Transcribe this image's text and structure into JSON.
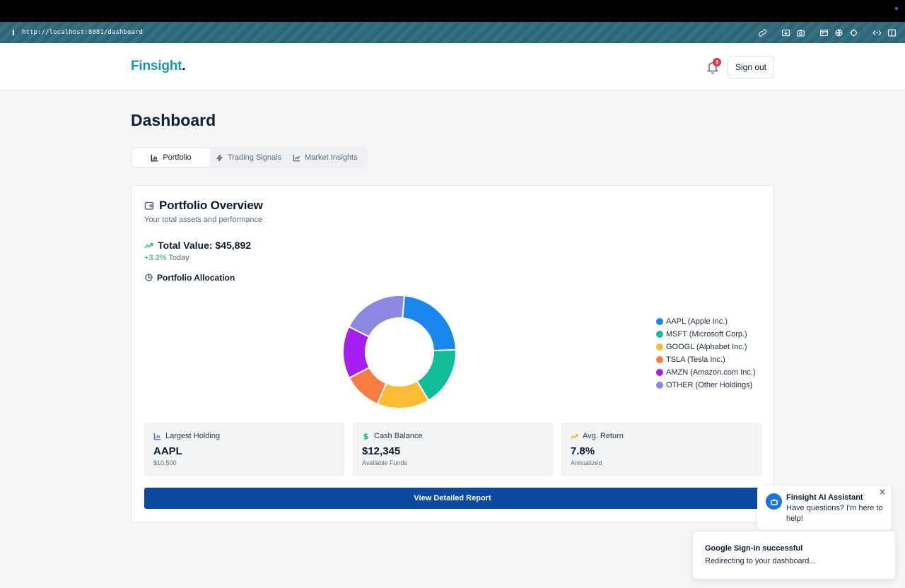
{
  "browser": {
    "url": "http://localhost:8081/dashboard",
    "info_glyph": "i",
    "toolbar_icons": [
      "link-icon",
      "download-icon",
      "camera-icon",
      "terminal-icon",
      "globe-icon",
      "crosshair-icon",
      "code-icon",
      "sidebar-icon"
    ]
  },
  "header": {
    "brand": "Finsight",
    "brand_suffix": ".",
    "notification_count": "3",
    "signout_label": "Sign out"
  },
  "page": {
    "title": "Dashboard"
  },
  "tabs": [
    {
      "label": "Portfolio",
      "icon": "bar-chart-icon",
      "active": true
    },
    {
      "label": "Trading Signals",
      "icon": "zap-icon",
      "active": false
    },
    {
      "label": "Market Insights",
      "icon": "line-chart-icon",
      "active": false
    }
  ],
  "overview": {
    "title": "Portfolio Overview",
    "subtitle": "Your total assets and performance",
    "total_value": "Total Value: $45,892",
    "change": "+3.2%",
    "change_suffix": " Today",
    "allocation_title": "Portfolio Allocation"
  },
  "chart_data": {
    "type": "pie",
    "donut": true,
    "title": "",
    "legend_position": "right",
    "categories": [
      "AAPL (Apple Inc.)",
      "MSFT (Microsoft Corp.)",
      "GOOGL (Alphabet Inc.)",
      "TSLA (Tesla Inc.)",
      "AMZN (Amazon.com Inc.)",
      "OTHER (Other Holdings)"
    ],
    "values": [
      23,
      17,
      15,
      11,
      15,
      19
    ],
    "colors": [
      "#1a87f0",
      "#12bd9a",
      "#fbbb33",
      "#fb7c43",
      "#a41ff0",
      "#8a88e0"
    ]
  },
  "stats": [
    {
      "label": "Largest Holding",
      "icon": "bar-chart-icon",
      "icon_color": "#4a6cf7",
      "value": "AAPL",
      "note": "$10,500"
    },
    {
      "label": "Cash Balance",
      "icon": "dollar-icon",
      "icon_color": "#22b05d",
      "value": "$12,345",
      "note": "Available Funds"
    },
    {
      "label": "Avg. Return",
      "icon": "trending-up-icon",
      "icon_color": "#f5a524",
      "value": "7.8%",
      "note": "Annualized"
    }
  ],
  "report_button": "View Detailed Report",
  "assistant": {
    "title": "Finsight AI Assistant",
    "message": "Have questions? I'm here to help!"
  },
  "toast": {
    "title": "Google Sign-in successful",
    "message": "Redirecting to your dashboard..."
  },
  "colors": {
    "brand": "#1a98b0",
    "primary_button": "#0b4aa0",
    "positive": "#22b05d",
    "badge": "#e0343f"
  }
}
